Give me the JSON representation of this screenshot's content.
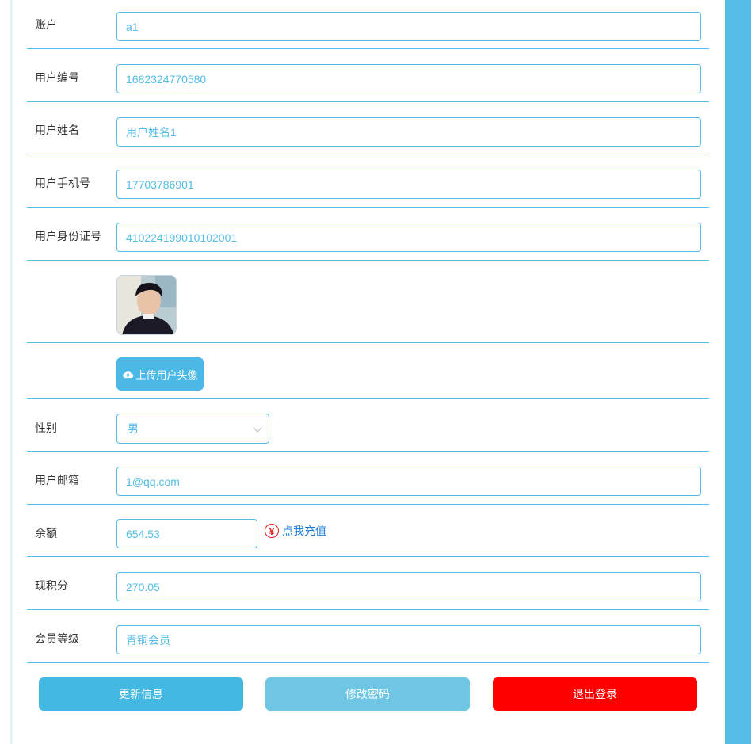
{
  "form": {
    "account": {
      "label": "账户",
      "value": "a1"
    },
    "user_no": {
      "label": "用户编号",
      "value": "1682324770580"
    },
    "user_name": {
      "label": "用户姓名",
      "value": "用户姓名1"
    },
    "phone": {
      "label": "用户手机号",
      "value": "17703786901"
    },
    "id_card": {
      "label": "用户身份证号",
      "value": "410224199010102001"
    },
    "upload_label": "上传用户头像",
    "gender": {
      "label": "性别",
      "value": "男"
    },
    "email": {
      "label": "用户邮箱",
      "value": "1@qq.com"
    },
    "balance": {
      "label": "余额",
      "value": "654.53",
      "recharge_label": "点我充值",
      "recharge_icon": "yen-circle-icon"
    },
    "points": {
      "label": "现积分",
      "value": "270.05"
    },
    "member_level": {
      "label": "会员等级",
      "value": "青铜会员"
    }
  },
  "buttons": {
    "update": "更新信息",
    "change_password": "修改密码",
    "logout": "退出登录"
  },
  "colors": {
    "accent": "#55bde6",
    "update_button": "#43b8e3",
    "password_button": "#6ec6e4",
    "logout_button": "#ff0000",
    "recharge_link": "#1e7ed8"
  }
}
